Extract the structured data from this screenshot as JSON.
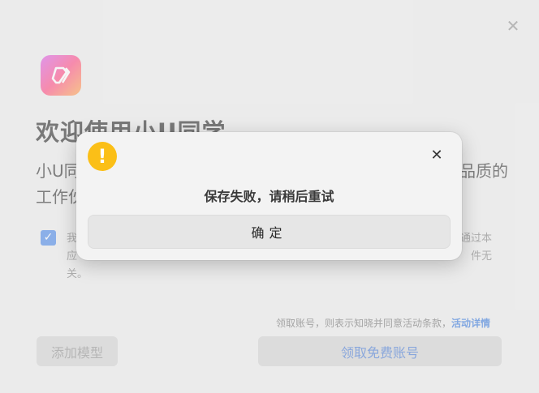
{
  "window": {
    "close_glyph": "✕",
    "title": "欢迎使用小U同学",
    "desc_line1": "小U同",
    "desc_line1_right": "品质的",
    "desc_line2": "工作伙",
    "agree_line1": "我",
    "agree_line1_right": "通过本",
    "agree_line2": "应",
    "agree_line2_right": "件无",
    "agree_line3": "关。",
    "terms_text": "领取账号，则表示知晓并同意活动条款，",
    "terms_link": "活动详情",
    "add_model_label": "添加模型",
    "claim_label": "领取免费账号"
  },
  "dialog": {
    "icon": "warning-icon",
    "icon_glyph": "!",
    "close_glyph": "✕",
    "message": "保存失败，请稍后重试",
    "confirm_label": "确定"
  },
  "colors": {
    "accent": "#3c7ee6",
    "warning": "#fbbf17",
    "link": "#2b6fd9"
  }
}
